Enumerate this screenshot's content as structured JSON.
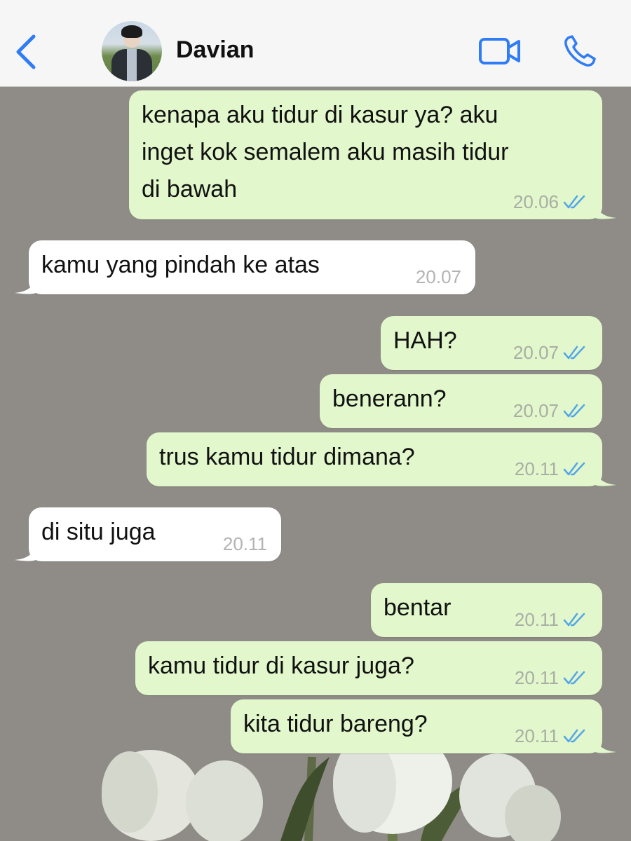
{
  "header": {
    "contact_name": "Davian",
    "accent_color": "#2f7cf6",
    "icons": [
      "chevron-left-icon",
      "video-camera-icon",
      "phone-icon"
    ]
  },
  "messages": [
    {
      "direction": "outgoing",
      "lines": [
        "kenapa aku tidur di kasur ya? aku",
        "inget kok semalem aku masih tidur",
        "di bawah"
      ],
      "time": "20.06",
      "read": true
    },
    {
      "direction": "incoming",
      "lines": [
        "kamu yang pindah ke atas"
      ],
      "time": "20.07"
    },
    {
      "direction": "outgoing",
      "lines": [
        "HAH?"
      ],
      "time": "20.07",
      "read": true
    },
    {
      "direction": "outgoing",
      "lines": [
        "benerann?"
      ],
      "time": "20.07",
      "read": true
    },
    {
      "direction": "outgoing",
      "lines": [
        "trus kamu tidur dimana?"
      ],
      "time": "20.11",
      "read": true
    },
    {
      "direction": "incoming",
      "lines": [
        "di situ juga"
      ],
      "time": "20.11"
    },
    {
      "direction": "outgoing",
      "lines": [
        "bentar"
      ],
      "time": "20.11",
      "read": true
    },
    {
      "direction": "outgoing",
      "lines": [
        "kamu tidur di kasur juga?"
      ],
      "time": "20.11",
      "read": true
    },
    {
      "direction": "outgoing",
      "lines": [
        "kita tidur bareng?"
      ],
      "time": "20.11",
      "read": true
    }
  ],
  "colors": {
    "outgoing_bubble": "#e2f7cb",
    "incoming_bubble": "#ffffff",
    "chat_background": "#8f8c87",
    "read_ticks": "#53a6e8"
  }
}
